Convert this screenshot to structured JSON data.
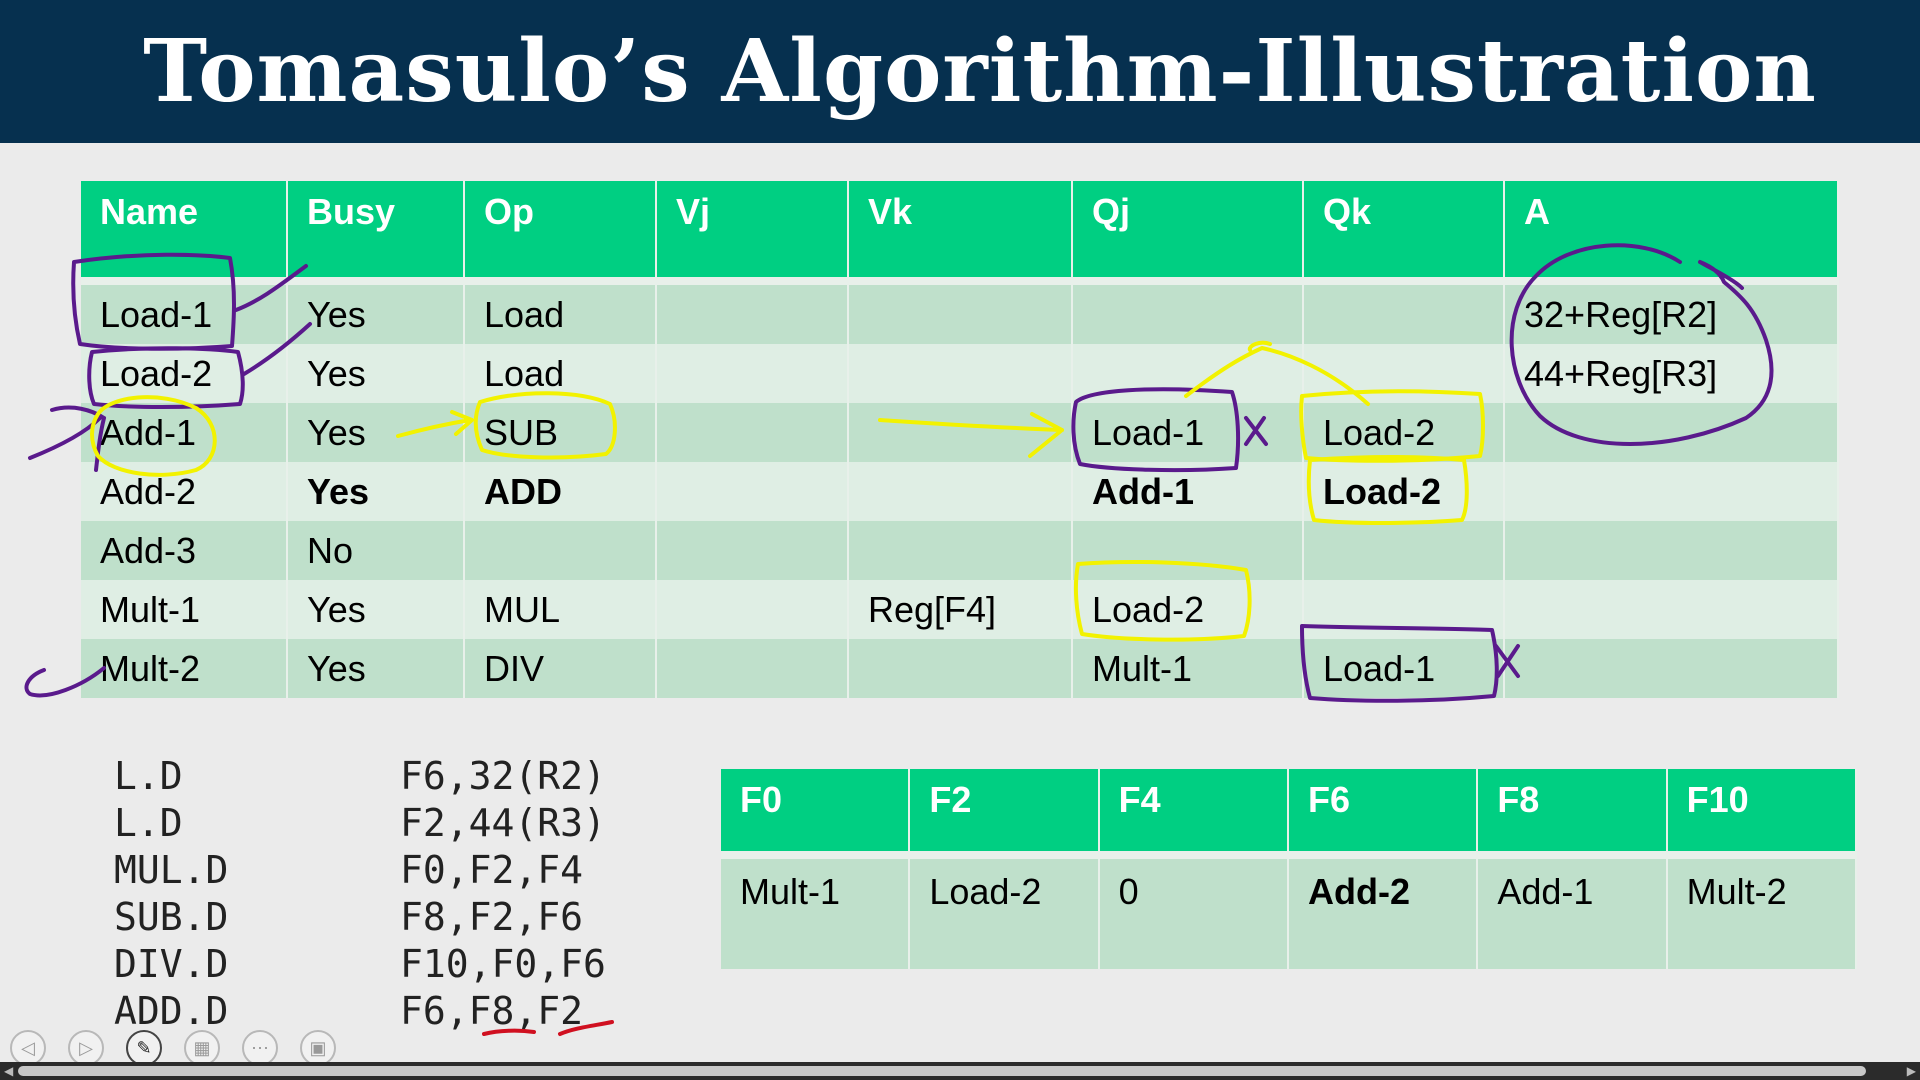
{
  "slide": {
    "title": "Tomasulo’s Algorithm-Illustration"
  },
  "reservation_stations": {
    "headers": [
      "Name",
      "Busy",
      "Op",
      "Vj",
      "Vk",
      "Qj",
      "Qk",
      "A"
    ],
    "rows": [
      {
        "name": "Load-1",
        "busy": "Yes",
        "op": "Load",
        "vj": "",
        "vk": "",
        "qj": "",
        "qk": "",
        "a": "32+Reg[R2]"
      },
      {
        "name": "Load-2",
        "busy": "Yes",
        "op": "Load",
        "vj": "",
        "vk": "",
        "qj": "",
        "qk": "",
        "a": "44+Reg[R3]"
      },
      {
        "name": "Add-1",
        "busy": "Yes",
        "op": "SUB",
        "vj": "",
        "vk": "",
        "qj": "Load-1",
        "qk": "Load-2",
        "a": ""
      },
      {
        "name": "Add-2",
        "busy": "Yes",
        "op": "ADD",
        "vj": "",
        "vk": "",
        "qj": "Add-1",
        "qk": "Load-2",
        "a": ""
      },
      {
        "name": "Add-3",
        "busy": "No",
        "op": "",
        "vj": "",
        "vk": "",
        "qj": "",
        "qk": "",
        "a": ""
      },
      {
        "name": "Mult-1",
        "busy": "Yes",
        "op": "MUL",
        "vj": "",
        "vk": "Reg[F4]",
        "qj": "Load-2",
        "qk": "",
        "a": ""
      },
      {
        "name": "Mult-2",
        "busy": "Yes",
        "op": "DIV",
        "vj": "",
        "vk": "",
        "qj": "Mult-1",
        "qk": "Load-1",
        "a": ""
      }
    ],
    "highlight_color": "#c00000"
  },
  "instructions": [
    {
      "op": "L.D",
      "args": "F6,32(R2)"
    },
    {
      "op": "L.D",
      "args": "F2,44(R3)"
    },
    {
      "op": "MUL.D",
      "args": "F0,F2,F4"
    },
    {
      "op": "SUB.D",
      "args": "F8,F2,F6"
    },
    {
      "op": "DIV.D",
      "args": "F10,F0,F6"
    },
    {
      "op": "ADD.D",
      "args": "F6,F8,F2"
    }
  ],
  "register_status": {
    "headers": [
      "F0",
      "F2",
      "F4",
      "F6",
      "F8",
      "F10"
    ],
    "values": [
      "Mult-1",
      "Load-2",
      "0",
      "Add-2",
      "Add-1",
      "Mult-2"
    ]
  },
  "colors": {
    "header_bg": "#06304f",
    "table_header": "#00cf82",
    "row_dark": "#bfe0cb",
    "row_light": "#dfeee4",
    "ink_purple": "#5a1a8c",
    "ink_yellow": "#f2f200",
    "ink_red": "#d01020"
  },
  "toolbar": {
    "icons": [
      "previous-icon",
      "next-icon",
      "pen-icon",
      "slides-icon",
      "more-icon",
      "screen-icon"
    ]
  }
}
